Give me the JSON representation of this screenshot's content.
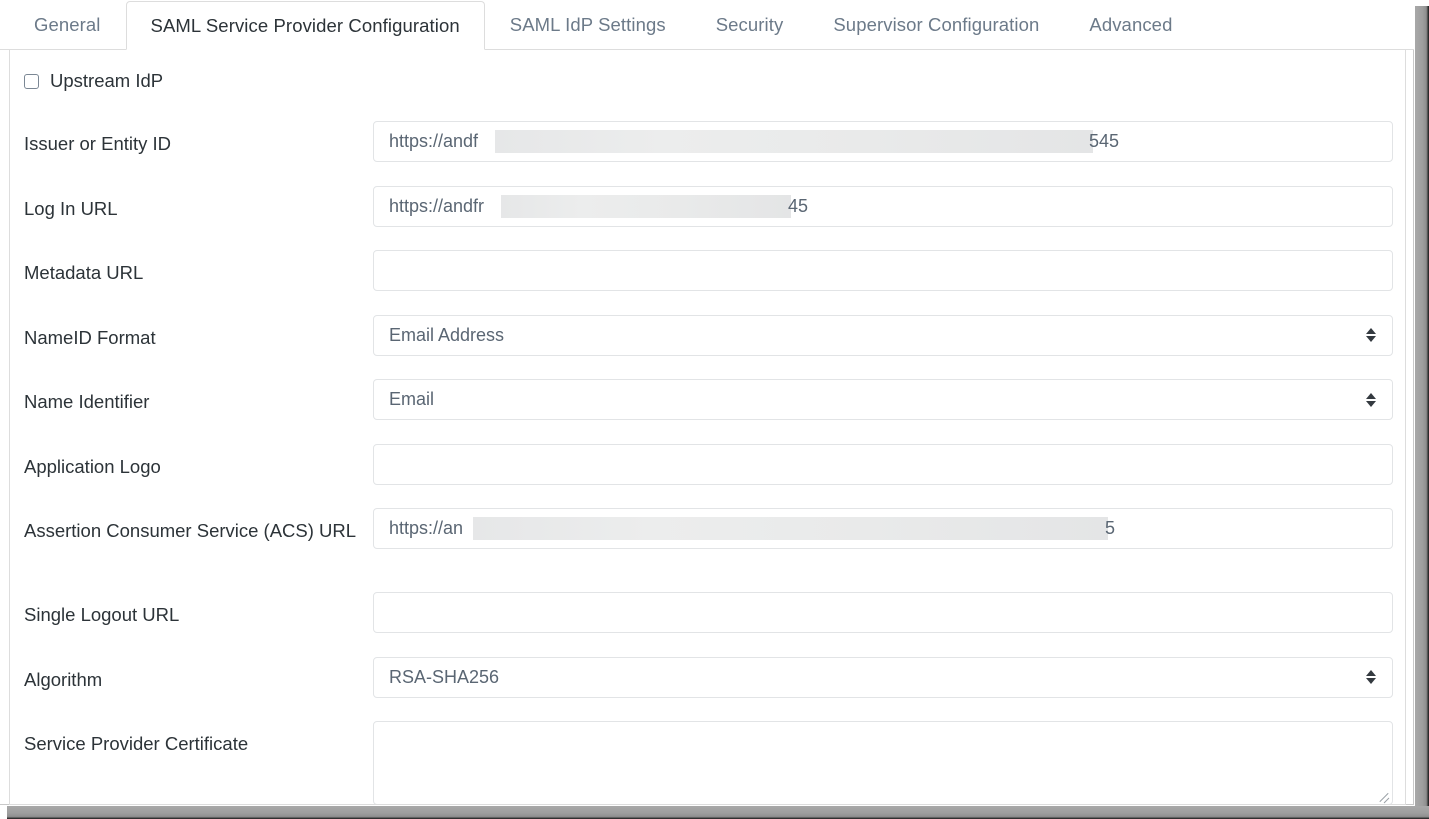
{
  "tabs": [
    {
      "label": "General",
      "active": false
    },
    {
      "label": "SAML Service Provider Configuration",
      "active": true
    },
    {
      "label": "SAML IdP Settings",
      "active": false
    },
    {
      "label": "Security",
      "active": false
    },
    {
      "label": "Supervisor Configuration",
      "active": false
    },
    {
      "label": "Advanced",
      "active": false
    }
  ],
  "upstream_idp": {
    "label": "Upstream IdP",
    "checked": false
  },
  "fields": {
    "issuer": {
      "label": "Issuer or Entity ID",
      "value_prefix": "https://andf",
      "value_suffix": "545",
      "redacted": true
    },
    "login_url": {
      "label": "Log In URL",
      "value_prefix": "https://andfr",
      "value_suffix": "45",
      "redacted": true
    },
    "metadata_url": {
      "label": "Metadata URL",
      "value": ""
    },
    "nameid_format": {
      "label": "NameID Format",
      "value": "Email Address",
      "options": [
        "Email Address"
      ]
    },
    "name_identifier": {
      "label": "Name Identifier",
      "value": "Email",
      "options": [
        "Email"
      ]
    },
    "application_logo": {
      "label": "Application Logo",
      "value": ""
    },
    "acs_url": {
      "label": "Assertion Consumer Service (ACS) URL",
      "value_prefix": "https://an",
      "value_suffix": "5",
      "redacted": true
    },
    "single_logout_url": {
      "label": "Single Logout URL",
      "value": ""
    },
    "algorithm": {
      "label": "Algorithm",
      "value": "RSA-SHA256",
      "options": [
        "RSA-SHA256"
      ]
    },
    "sp_certificate": {
      "label": "Service Provider Certificate",
      "value": ""
    }
  },
  "colors": {
    "tab_active_text": "#2c3338",
    "tab_inactive_text": "#6c7a89",
    "label_text": "#2c3338",
    "input_text": "#5a6673",
    "input_border": "#e2e4e6",
    "panel_border": "#dddddd",
    "redaction": "#e9eaea"
  }
}
